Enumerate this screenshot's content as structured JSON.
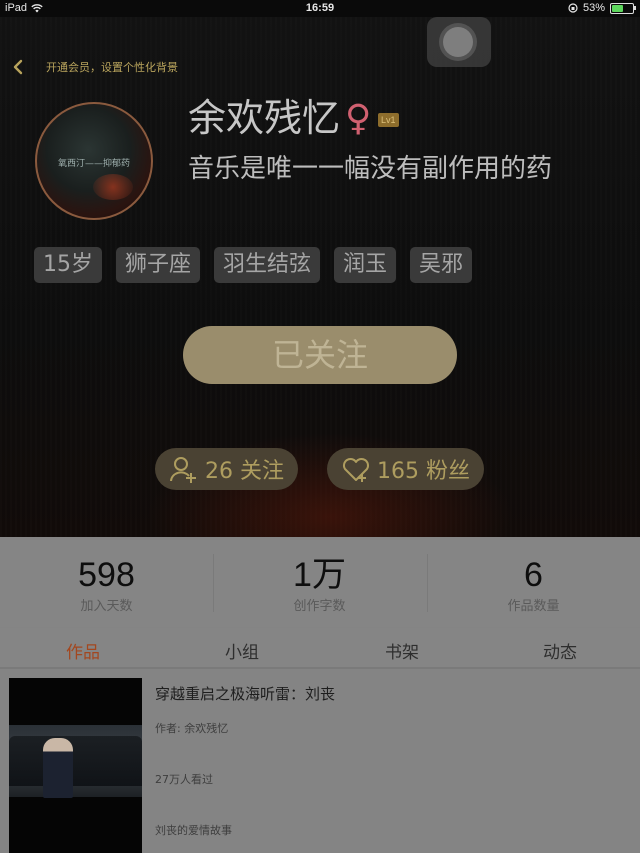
{
  "status_bar": {
    "device": "iPad",
    "time": "16:59",
    "battery_percent": "53%",
    "battery_level": 0.53
  },
  "header": {
    "back_icon": "chevron-left-icon",
    "vip_text": "开通会员，设置个性化背景",
    "avatar_text": "氧西汀——抑郁药",
    "username": "余欢残忆",
    "gender_symbol": "♀",
    "level": "Lv1",
    "signature": "音乐是唯一一幅没有副作用的药",
    "tags": [
      "15岁",
      "狮子座",
      "羽生结弦",
      "润玉",
      "吴邪"
    ],
    "follow_button": "已关注",
    "following": "26 关注",
    "fans": "165 粉丝",
    "colors": {
      "accent": "#ae9d5f",
      "female": "#d06070"
    }
  },
  "stats": [
    {
      "value": "598",
      "label": "加入天数"
    },
    {
      "value": "1万",
      "label": "创作字数"
    },
    {
      "value": "6",
      "label": "作品数量"
    }
  ],
  "tabs": [
    {
      "label": "作品",
      "active": true
    },
    {
      "label": "小组",
      "active": false
    },
    {
      "label": "书架",
      "active": false
    },
    {
      "label": "动态",
      "active": false
    }
  ],
  "book": {
    "title": "穿越重启之极海听雷：刘丧",
    "author": "作者: 余欢残忆",
    "views": "27万人看过",
    "description": "刘丧的爱情故事"
  }
}
